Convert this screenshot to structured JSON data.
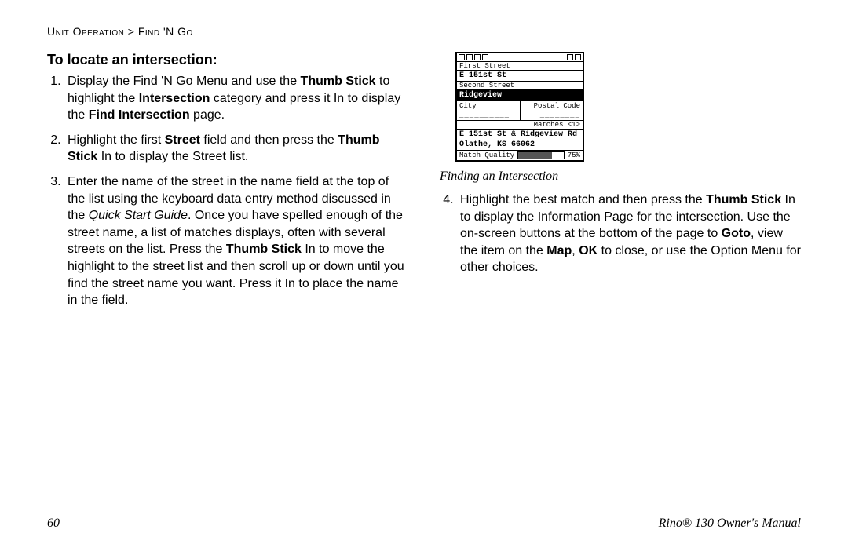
{
  "breadcrumb": "Unit Operation > Find 'N Go",
  "heading": "To locate an intersection:",
  "steps_left": [
    {
      "num": "1.",
      "parts": [
        {
          "t": "Display the Find 'N Go Menu and use the "
        },
        {
          "t": "Thumb Stick",
          "b": true
        },
        {
          "t": " to highlight the "
        },
        {
          "t": "Intersection",
          "b": true
        },
        {
          "t": " category and press it In to display the "
        },
        {
          "t": "Find Intersection",
          "b": true
        },
        {
          "t": " page."
        }
      ]
    },
    {
      "num": "2.",
      "parts": [
        {
          "t": "Highlight the first "
        },
        {
          "t": "Street",
          "b": true
        },
        {
          "t": " field and then press the "
        },
        {
          "t": "Thumb Stick",
          "b": true
        },
        {
          "t": " In to display the Street list."
        }
      ]
    },
    {
      "num": "3.",
      "parts": [
        {
          "t": "Enter the name of the street in the name field at the top of the list using the keyboard data entry method discussed in the "
        },
        {
          "t": "Quick Start Guide",
          "i": true
        },
        {
          "t": ". Once you have spelled enough of the street name, a list of matches displays, often with several streets on the list. Press the "
        },
        {
          "t": "Thumb Stick",
          "b": true
        },
        {
          "t": " In to move the highlight to the street list and then scroll up or down until you find the street name you want. Press it In to place the name in the field."
        }
      ]
    }
  ],
  "steps_right": [
    {
      "num": "4.",
      "parts": [
        {
          "t": "Highlight the best match and then press the "
        },
        {
          "t": "Thumb Stick",
          "b": true
        },
        {
          "t": " In to display the Information Page for the intersection. Use the on-screen buttons at the bottom of the page to "
        },
        {
          "t": "Goto",
          "b": true
        },
        {
          "t": ", view the item on the "
        },
        {
          "t": "Map",
          "b": true
        },
        {
          "t": ", "
        },
        {
          "t": "OK",
          "b": true
        },
        {
          "t": " to close, or use the Option Menu for other choices."
        }
      ]
    }
  ],
  "caption": "Finding an Intersection",
  "device": {
    "first_label": "First Street",
    "first_value": "E 151st St",
    "second_label": "Second Street",
    "second_value": "Ridgeview",
    "city_label": "City",
    "postal_label": "Postal Code",
    "city_value": "__________",
    "postal_value": "________",
    "matches_label": "Matches <1>",
    "match_line1": "E 151st St & Ridgeview Rd",
    "match_line2": "Olathe, KS 66062",
    "quality_label": "Match Quality",
    "quality_pct": "75%"
  },
  "footer": {
    "page_num": "60",
    "manual": "Rino® 130 Owner's Manual"
  }
}
